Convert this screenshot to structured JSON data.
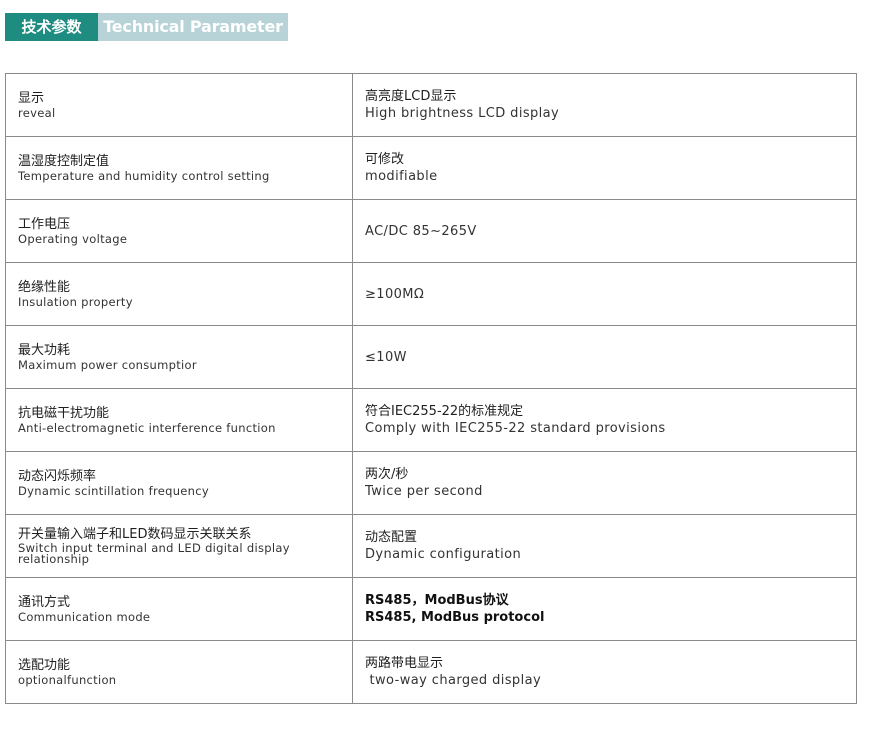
{
  "header": {
    "title_cn": "技术参数",
    "title_en": "Technical Parameter"
  },
  "colors": {
    "header_cn_bg": "#1e8c80",
    "header_en_bg": "#b8d3d8",
    "border": "#8a8a8a"
  },
  "rows": [
    {
      "name_cn": "显示",
      "name_en": "reveal",
      "value_cn": "高亮度LCD显示",
      "value_en": "High brightness LCD display"
    },
    {
      "name_cn": "温湿度控制定值",
      "name_en": "Temperature and humidity control setting",
      "value_cn": "可修改",
      "value_en": "modifiable"
    },
    {
      "name_cn": "工作电压",
      "name_en": "Operating voltage",
      "value_cn": "",
      "value_en": "AC/DC 85~265V"
    },
    {
      "name_cn": "绝缘性能",
      "name_en": "Insulation property",
      "value_cn": "",
      "value_en": "≥100MΩ"
    },
    {
      "name_cn": "最大功耗",
      "name_en": "Maximum power consumptior",
      "value_cn": "",
      "value_en": "≤10W"
    },
    {
      "name_cn": "抗电磁干扰功能",
      "name_en": "Anti-electromagnetic interference function",
      "value_cn": "符合IEC255-22的标准规定",
      "value_en": "Comply with IEC255-22 standard provisions"
    },
    {
      "name_cn": "动态闪烁频率",
      "name_en": "Dynamic scintillation frequency",
      "value_cn": "两次/秒",
      "value_en": "Twice per second"
    },
    {
      "name_cn": "开关量输入端子和LED数码显示关联关系",
      "name_en": "Switch input terminal and LED digital display relationship",
      "value_cn": "动态配置",
      "value_en": "Dynamic configuration"
    },
    {
      "name_cn": "通讯方式",
      "name_en": "Communication mode",
      "value_cn": "RS485，ModBus协议",
      "value_en": "RS485, ModBus protocol"
    },
    {
      "name_cn": "选配功能",
      "name_en": "optionalfunction",
      "value_cn": "两路带电显示",
      "value_en": " two-way charged display"
    }
  ]
}
